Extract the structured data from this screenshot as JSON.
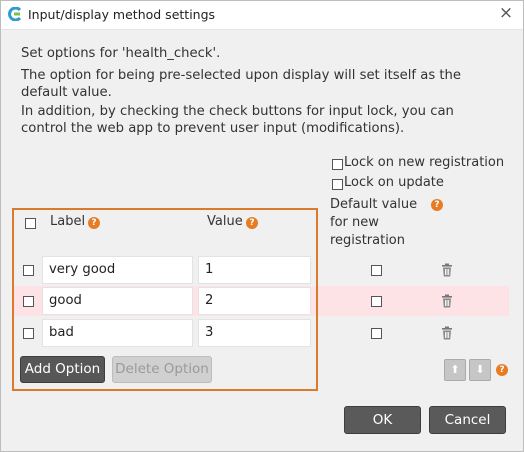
{
  "window": {
    "title": "Input/display method settings",
    "close_glyph": "×",
    "app_icon": "app-logo-icon"
  },
  "description": {
    "line1": "Set options for 'health_check'.",
    "line2": "The option for being pre-selected upon display will set itself as the",
    "line3": "default value.",
    "line4": "In addition, by checking the check buttons for input lock, you can",
    "line5": "control the web app to prevent user input (modifications)."
  },
  "locks": {
    "new_registration": "Lock on new registration",
    "update": "Lock on update"
  },
  "headers": {
    "label": "Label",
    "value": "Value",
    "default_line1": "Default value",
    "default_line2": "for new",
    "default_line3": "registration",
    "help_glyph": "?"
  },
  "options": [
    {
      "label": "very good",
      "value": "1",
      "highlighted": false
    },
    {
      "label": "good",
      "value": "2",
      "highlighted": true
    },
    {
      "label": "bad",
      "value": "3",
      "highlighted": false
    }
  ],
  "buttons": {
    "add_option": "Add Option",
    "delete_option": "Delete Option",
    "ok": "OK",
    "cancel": "Cancel",
    "move_up": "⬆",
    "move_down": "⬇"
  },
  "colors": {
    "accent_orange": "#d97a2c",
    "help_icon": "#e87c24",
    "row_highlight": "#fde2e6",
    "dark_button": "#575757"
  }
}
